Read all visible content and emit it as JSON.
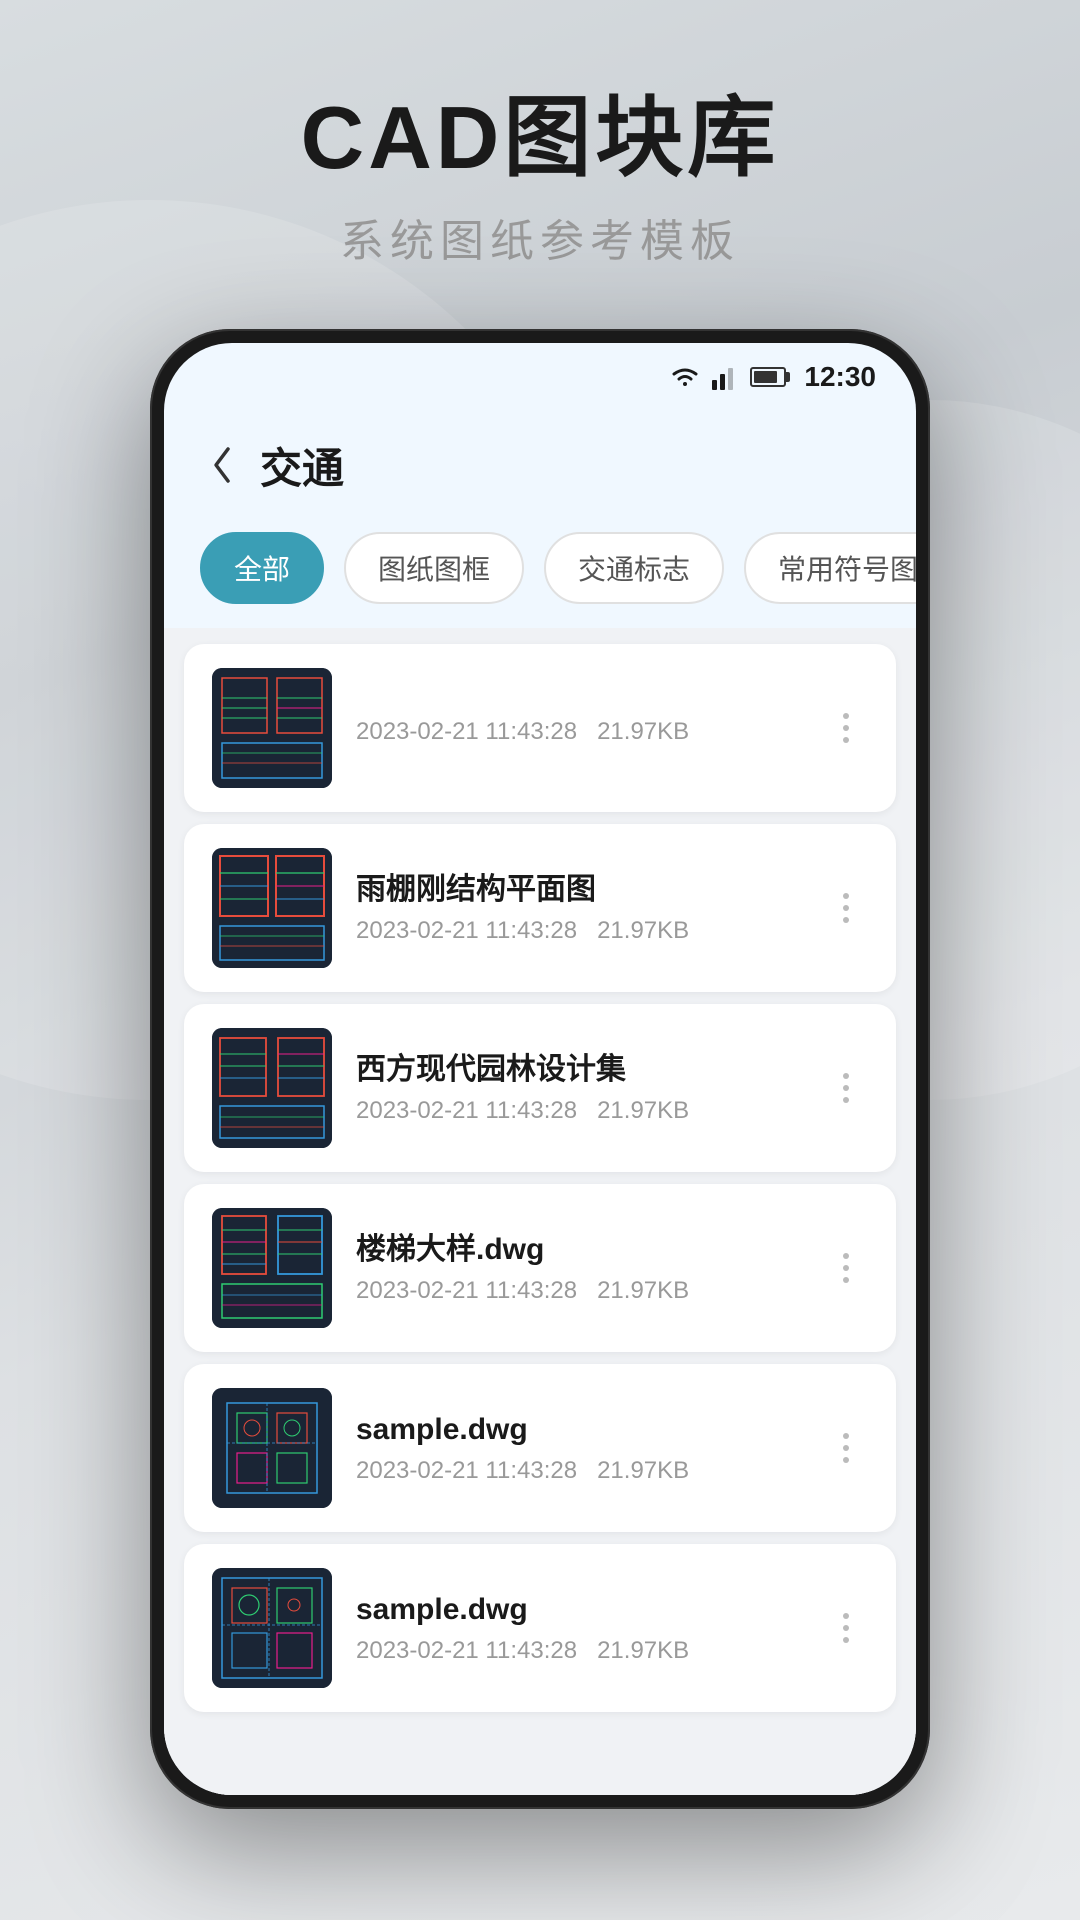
{
  "page": {
    "title": "CAD图块库",
    "subtitle": "系统图纸参考模板"
  },
  "status_bar": {
    "time": "12:30"
  },
  "nav": {
    "back_label": "‹",
    "title": "交通"
  },
  "filter_tabs": [
    {
      "id": "all",
      "label": "全部",
      "active": true
    },
    {
      "id": "frame",
      "label": "图纸图框",
      "active": false
    },
    {
      "id": "sign",
      "label": "交通标志",
      "active": false
    },
    {
      "id": "symbol",
      "label": "常用符号图例",
      "active": false
    }
  ],
  "files": [
    {
      "id": 1,
      "name": "",
      "date": "2023-02-21 11:43:28",
      "size": "21.97KB"
    },
    {
      "id": 2,
      "name": "雨棚刚结构平面图",
      "date": "2023-02-21 11:43:28",
      "size": "21.97KB"
    },
    {
      "id": 3,
      "name": "西方现代园林设计集",
      "date": "2023-02-21 11:43:28",
      "size": "21.97KB"
    },
    {
      "id": 4,
      "name": "楼梯大样.dwg",
      "date": "2023-02-21 11:43:28",
      "size": "21.97KB"
    },
    {
      "id": 5,
      "name": "sample.dwg",
      "date": "2023-02-21 11:43:28",
      "size": "21.97KB"
    },
    {
      "id": 6,
      "name": "sample.dwg",
      "date": "2023-02-21 11:43:28",
      "size": "21.97KB"
    }
  ]
}
